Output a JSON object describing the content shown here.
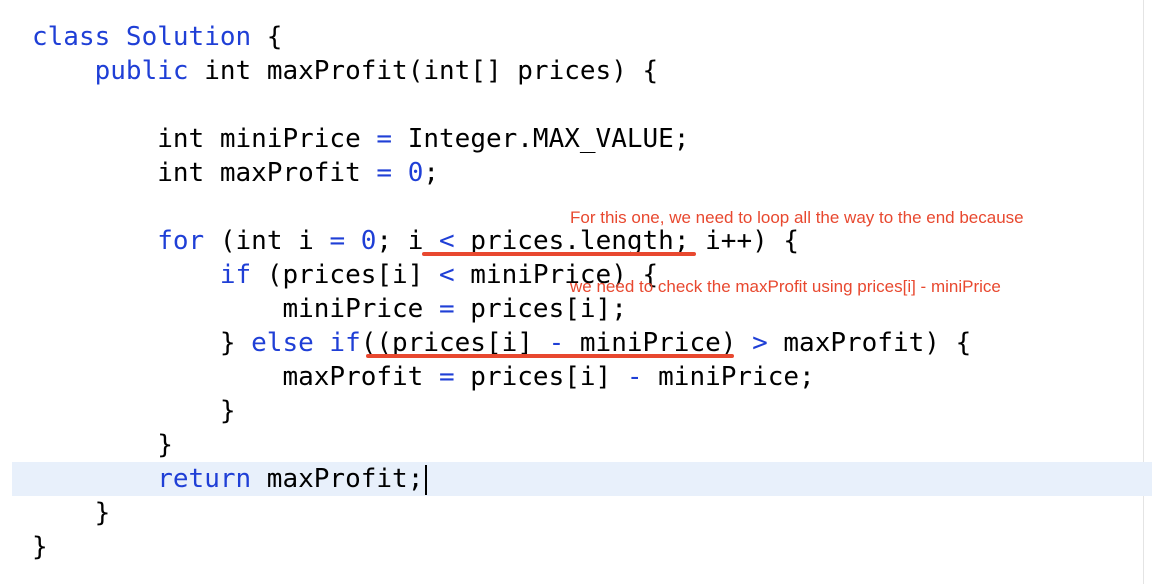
{
  "code": {
    "lines": [
      {
        "indent": "",
        "tokens": [
          {
            "t": "class ",
            "c": "kw"
          },
          {
            "t": "Solution",
            "c": "kw"
          },
          {
            "t": " {",
            "c": ""
          }
        ]
      },
      {
        "indent": "    ",
        "tokens": [
          {
            "t": "public ",
            "c": "kw"
          },
          {
            "t": "int maxProfit(int[] prices) {",
            "c": ""
          }
        ]
      },
      {
        "indent": "",
        "tokens": []
      },
      {
        "indent": "        ",
        "tokens": [
          {
            "t": "int miniPrice ",
            "c": ""
          },
          {
            "t": "=",
            "c": "op"
          },
          {
            "t": " Integer.MAX_VALUE;",
            "c": ""
          }
        ]
      },
      {
        "indent": "        ",
        "tokens": [
          {
            "t": "int maxProfit ",
            "c": ""
          },
          {
            "t": "=",
            "c": "op"
          },
          {
            "t": " ",
            "c": ""
          },
          {
            "t": "0",
            "c": "num"
          },
          {
            "t": ";",
            "c": ""
          }
        ]
      },
      {
        "indent": "",
        "tokens": []
      },
      {
        "indent": "        ",
        "tokens": [
          {
            "t": "for",
            "c": "kw"
          },
          {
            "t": " (int i ",
            "c": ""
          },
          {
            "t": "=",
            "c": "op"
          },
          {
            "t": " ",
            "c": ""
          },
          {
            "t": "0",
            "c": "num"
          },
          {
            "t": "; i ",
            "c": ""
          },
          {
            "t": "<",
            "c": "op"
          },
          {
            "t": " prices.length; i++) {",
            "c": ""
          }
        ]
      },
      {
        "indent": "            ",
        "tokens": [
          {
            "t": "if",
            "c": "kw"
          },
          {
            "t": " (prices[i] ",
            "c": ""
          },
          {
            "t": "<",
            "c": "op"
          },
          {
            "t": " miniPrice) {",
            "c": ""
          }
        ]
      },
      {
        "indent": "                ",
        "tokens": [
          {
            "t": "miniPrice ",
            "c": ""
          },
          {
            "t": "=",
            "c": "op"
          },
          {
            "t": " prices[i];",
            "c": ""
          }
        ]
      },
      {
        "indent": "            ",
        "tokens": [
          {
            "t": "} ",
            "c": ""
          },
          {
            "t": "else if",
            "c": "kw"
          },
          {
            "t": "((prices[i] ",
            "c": ""
          },
          {
            "t": "-",
            "c": "op"
          },
          {
            "t": " miniPrice) ",
            "c": ""
          },
          {
            "t": ">",
            "c": "op"
          },
          {
            "t": " maxProfit) {",
            "c": ""
          }
        ]
      },
      {
        "indent": "                ",
        "tokens": [
          {
            "t": "maxProfit ",
            "c": ""
          },
          {
            "t": "=",
            "c": "op"
          },
          {
            "t": " prices[i] ",
            "c": ""
          },
          {
            "t": "-",
            "c": "op"
          },
          {
            "t": " miniPrice;",
            "c": ""
          }
        ]
      },
      {
        "indent": "            ",
        "tokens": [
          {
            "t": "}",
            "c": ""
          }
        ]
      },
      {
        "indent": "        ",
        "tokens": [
          {
            "t": "}",
            "c": ""
          }
        ]
      },
      {
        "indent": "        ",
        "tokens": [
          {
            "t": "return",
            "c": "kw"
          },
          {
            "t": " maxProfit;",
            "c": ""
          }
        ]
      },
      {
        "indent": "    ",
        "tokens": [
          {
            "t": "}",
            "c": ""
          }
        ]
      },
      {
        "indent": "",
        "tokens": [
          {
            "t": "}",
            "c": ""
          }
        ]
      }
    ],
    "cursor_line": 13
  },
  "annotation": {
    "line1": "For this one, we need to loop all the way to the end because",
    "line2": "we need to check the maxProfit using prices[i] - miniPrice"
  },
  "colors": {
    "keyword": "#1f3fd6",
    "annotation": "#e8482f",
    "current_line": "#e8f0fb"
  }
}
